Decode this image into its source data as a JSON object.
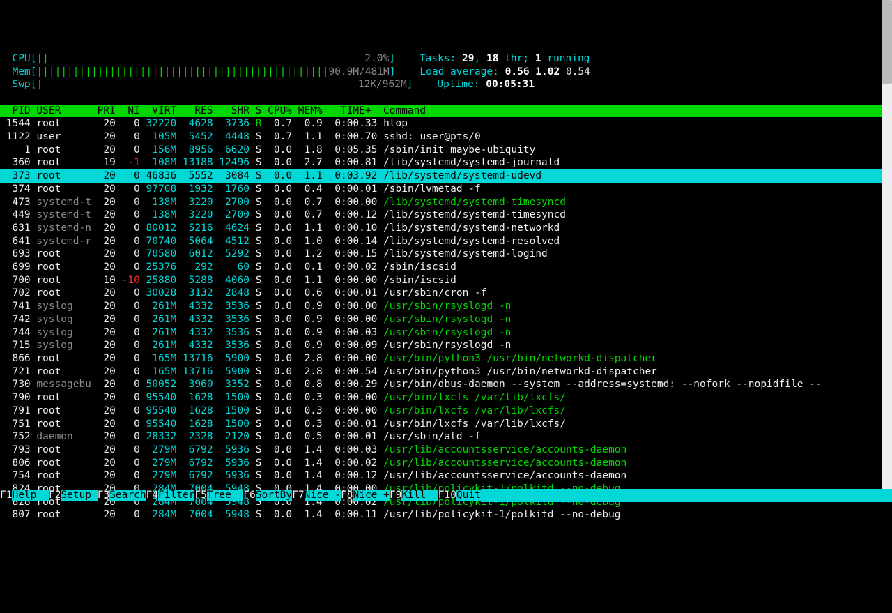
{
  "meters": {
    "cpu": {
      "label": "CPU",
      "bar": "||",
      "pct": "2.0%"
    },
    "mem": {
      "label": "Mem",
      "bar": "||||||||||||||||||||||||||||||||||||||||||||||||",
      "val": "90.9M/481M"
    },
    "swp": {
      "label": "Swp",
      "bar": "|",
      "val": "12K/962M"
    }
  },
  "stats": {
    "tasks_label": "Tasks: ",
    "tasks_total": "29",
    "tasks_thr": "18",
    "tasks_thr_label": " thr; ",
    "tasks_running": "1",
    "tasks_running_label": " running",
    "load_label": "Load average: ",
    "load1": "0.56",
    "load2": "1.02",
    "load3": "0.54",
    "uptime_label": "Uptime: ",
    "uptime": "00:05:31"
  },
  "columns": "  PID USER      PRI  NI  VIRT   RES   SHR S CPU% MEM%   TIME+  Command",
  "selected_pid": "373",
  "processes": [
    {
      "pid": "1544",
      "user": "root",
      "pri": "20",
      "ni": "0",
      "virt": "32220",
      "res": "4628",
      "shr": "3736",
      "s": "R",
      "cpu": "0.7",
      "mem": "0.9",
      "time": "0:00.33",
      "cmd": "htop",
      "hl": false,
      "scol": "green"
    },
    {
      "pid": "1122",
      "user": "user",
      "pri": "20",
      "ni": "0",
      "virt": "105M",
      "res": "5452",
      "shr": "4448",
      "s": "S",
      "cpu": "0.7",
      "mem": "1.1",
      "time": "0:00.70",
      "cmd": "sshd: user@pts/0",
      "hl": false,
      "scol": ""
    },
    {
      "pid": "1",
      "user": "root",
      "pri": "20",
      "ni": "0",
      "virt": "156M",
      "res": "8956",
      "shr": "6620",
      "s": "S",
      "cpu": "0.0",
      "mem": "1.8",
      "time": "0:05.35",
      "cmd": "/sbin/init maybe-ubiquity",
      "hl": false,
      "scol": ""
    },
    {
      "pid": "360",
      "user": "root",
      "pri": "19",
      "ni": "-1",
      "virt": "108M",
      "res": "13188",
      "shr": "12496",
      "s": "S",
      "cpu": "0.0",
      "mem": "2.7",
      "time": "0:00.81",
      "cmd": "/lib/systemd/systemd-journald",
      "hl": false,
      "scol": "",
      "nred": true
    },
    {
      "pid": "373",
      "user": "root",
      "pri": "20",
      "ni": "0",
      "virt": "46836",
      "res": "5552",
      "shr": "3084",
      "s": "S",
      "cpu": "0.0",
      "mem": "1.1",
      "time": "0:03.92",
      "cmd": "/lib/systemd/systemd-udevd",
      "hl": false,
      "scol": ""
    },
    {
      "pid": "374",
      "user": "root",
      "pri": "20",
      "ni": "0",
      "virt": "97708",
      "res": "1932",
      "shr": "1760",
      "s": "S",
      "cpu": "0.0",
      "mem": "0.4",
      "time": "0:00.01",
      "cmd": "/sbin/lvmetad -f",
      "hl": false,
      "scol": ""
    },
    {
      "pid": "473",
      "user": "systemd-t",
      "pri": "20",
      "ni": "0",
      "virt": "138M",
      "res": "3220",
      "shr": "2700",
      "s": "S",
      "cpu": "0.0",
      "mem": "0.7",
      "time": "0:00.00",
      "cmd": "/lib/systemd/systemd-timesyncd",
      "hl": true,
      "scol": ""
    },
    {
      "pid": "449",
      "user": "systemd-t",
      "pri": "20",
      "ni": "0",
      "virt": "138M",
      "res": "3220",
      "shr": "2700",
      "s": "S",
      "cpu": "0.0",
      "mem": "0.7",
      "time": "0:00.12",
      "cmd": "/lib/systemd/systemd-timesyncd",
      "hl": false,
      "scol": ""
    },
    {
      "pid": "631",
      "user": "systemd-n",
      "pri": "20",
      "ni": "0",
      "virt": "80012",
      "res": "5216",
      "shr": "4624",
      "s": "S",
      "cpu": "0.0",
      "mem": "1.1",
      "time": "0:00.10",
      "cmd": "/lib/systemd/systemd-networkd",
      "hl": false,
      "scol": ""
    },
    {
      "pid": "641",
      "user": "systemd-r",
      "pri": "20",
      "ni": "0",
      "virt": "70740",
      "res": "5064",
      "shr": "4512",
      "s": "S",
      "cpu": "0.0",
      "mem": "1.0",
      "time": "0:00.14",
      "cmd": "/lib/systemd/systemd-resolved",
      "hl": false,
      "scol": ""
    },
    {
      "pid": "693",
      "user": "root",
      "pri": "20",
      "ni": "0",
      "virt": "70580",
      "res": "6012",
      "shr": "5292",
      "s": "S",
      "cpu": "0.0",
      "mem": "1.2",
      "time": "0:00.15",
      "cmd": "/lib/systemd/systemd-logind",
      "hl": false,
      "scol": ""
    },
    {
      "pid": "699",
      "user": "root",
      "pri": "20",
      "ni": "0",
      "virt": "25376",
      "res": "292",
      "shr": "60",
      "s": "S",
      "cpu": "0.0",
      "mem": "0.1",
      "time": "0:00.02",
      "cmd": "/sbin/iscsid",
      "hl": false,
      "scol": ""
    },
    {
      "pid": "700",
      "user": "root",
      "pri": "10",
      "ni": "-10",
      "virt": "25880",
      "res": "5288",
      "shr": "4060",
      "s": "S",
      "cpu": "0.0",
      "mem": "1.1",
      "time": "0:00.00",
      "cmd": "/sbin/iscsid",
      "hl": false,
      "scol": "",
      "nred": true
    },
    {
      "pid": "702",
      "user": "root",
      "pri": "20",
      "ni": "0",
      "virt": "30028",
      "res": "3132",
      "shr": "2848",
      "s": "S",
      "cpu": "0.0",
      "mem": "0.6",
      "time": "0:00.01",
      "cmd": "/usr/sbin/cron -f",
      "hl": false,
      "scol": ""
    },
    {
      "pid": "741",
      "user": "syslog",
      "pri": "20",
      "ni": "0",
      "virt": "261M",
      "res": "4332",
      "shr": "3536",
      "s": "S",
      "cpu": "0.0",
      "mem": "0.9",
      "time": "0:00.00",
      "cmd": "/usr/sbin/rsyslogd -n",
      "hl": true,
      "scol": ""
    },
    {
      "pid": "742",
      "user": "syslog",
      "pri": "20",
      "ni": "0",
      "virt": "261M",
      "res": "4332",
      "shr": "3536",
      "s": "S",
      "cpu": "0.0",
      "mem": "0.9",
      "time": "0:00.00",
      "cmd": "/usr/sbin/rsyslogd -n",
      "hl": true,
      "scol": ""
    },
    {
      "pid": "744",
      "user": "syslog",
      "pri": "20",
      "ni": "0",
      "virt": "261M",
      "res": "4332",
      "shr": "3536",
      "s": "S",
      "cpu": "0.0",
      "mem": "0.9",
      "time": "0:00.03",
      "cmd": "/usr/sbin/rsyslogd -n",
      "hl": true,
      "scol": ""
    },
    {
      "pid": "715",
      "user": "syslog",
      "pri": "20",
      "ni": "0",
      "virt": "261M",
      "res": "4332",
      "shr": "3536",
      "s": "S",
      "cpu": "0.0",
      "mem": "0.9",
      "time": "0:00.09",
      "cmd": "/usr/sbin/rsyslogd -n",
      "hl": false,
      "scol": ""
    },
    {
      "pid": "866",
      "user": "root",
      "pri": "20",
      "ni": "0",
      "virt": "165M",
      "res": "13716",
      "shr": "5900",
      "s": "S",
      "cpu": "0.0",
      "mem": "2.8",
      "time": "0:00.00",
      "cmd": "/usr/bin/python3 /usr/bin/networkd-dispatcher",
      "hl": true,
      "scol": ""
    },
    {
      "pid": "721",
      "user": "root",
      "pri": "20",
      "ni": "0",
      "virt": "165M",
      "res": "13716",
      "shr": "5900",
      "s": "S",
      "cpu": "0.0",
      "mem": "2.8",
      "time": "0:00.54",
      "cmd": "/usr/bin/python3 /usr/bin/networkd-dispatcher",
      "hl": false,
      "scol": ""
    },
    {
      "pid": "730",
      "user": "messagebu",
      "pri": "20",
      "ni": "0",
      "virt": "50052",
      "res": "3960",
      "shr": "3352",
      "s": "S",
      "cpu": "0.0",
      "mem": "0.8",
      "time": "0:00.29",
      "cmd": "/usr/bin/dbus-daemon --system --address=systemd: --nofork --nopidfile --",
      "hl": false,
      "scol": ""
    },
    {
      "pid": "790",
      "user": "root",
      "pri": "20",
      "ni": "0",
      "virt": "95540",
      "res": "1628",
      "shr": "1500",
      "s": "S",
      "cpu": "0.0",
      "mem": "0.3",
      "time": "0:00.00",
      "cmd": "/usr/bin/lxcfs /var/lib/lxcfs/",
      "hl": true,
      "scol": ""
    },
    {
      "pid": "791",
      "user": "root",
      "pri": "20",
      "ni": "0",
      "virt": "95540",
      "res": "1628",
      "shr": "1500",
      "s": "S",
      "cpu": "0.0",
      "mem": "0.3",
      "time": "0:00.00",
      "cmd": "/usr/bin/lxcfs /var/lib/lxcfs/",
      "hl": true,
      "scol": ""
    },
    {
      "pid": "751",
      "user": "root",
      "pri": "20",
      "ni": "0",
      "virt": "95540",
      "res": "1628",
      "shr": "1500",
      "s": "S",
      "cpu": "0.0",
      "mem": "0.3",
      "time": "0:00.01",
      "cmd": "/usr/bin/lxcfs /var/lib/lxcfs/",
      "hl": false,
      "scol": ""
    },
    {
      "pid": "752",
      "user": "daemon",
      "pri": "20",
      "ni": "0",
      "virt": "28332",
      "res": "2328",
      "shr": "2120",
      "s": "S",
      "cpu": "0.0",
      "mem": "0.5",
      "time": "0:00.01",
      "cmd": "/usr/sbin/atd -f",
      "hl": false,
      "scol": ""
    },
    {
      "pid": "793",
      "user": "root",
      "pri": "20",
      "ni": "0",
      "virt": "279M",
      "res": "6792",
      "shr": "5936",
      "s": "S",
      "cpu": "0.0",
      "mem": "1.4",
      "time": "0:00.03",
      "cmd": "/usr/lib/accountsservice/accounts-daemon",
      "hl": true,
      "scol": ""
    },
    {
      "pid": "806",
      "user": "root",
      "pri": "20",
      "ni": "0",
      "virt": "279M",
      "res": "6792",
      "shr": "5936",
      "s": "S",
      "cpu": "0.0",
      "mem": "1.4",
      "time": "0:00.02",
      "cmd": "/usr/lib/accountsservice/accounts-daemon",
      "hl": true,
      "scol": ""
    },
    {
      "pid": "754",
      "user": "root",
      "pri": "20",
      "ni": "0",
      "virt": "279M",
      "res": "6792",
      "shr": "5936",
      "s": "S",
      "cpu": "0.0",
      "mem": "1.4",
      "time": "0:00.12",
      "cmd": "/usr/lib/accountsservice/accounts-daemon",
      "hl": false,
      "scol": ""
    },
    {
      "pid": "824",
      "user": "root",
      "pri": "20",
      "ni": "0",
      "virt": "284M",
      "res": "7004",
      "shr": "5948",
      "s": "S",
      "cpu": "0.0",
      "mem": "1.4",
      "time": "0:00.00",
      "cmd": "/usr/lib/policykit-1/polkitd --no-debug",
      "hl": true,
      "scol": ""
    },
    {
      "pid": "828",
      "user": "root",
      "pri": "20",
      "ni": "0",
      "virt": "284M",
      "res": "7004",
      "shr": "5948",
      "s": "S",
      "cpu": "0.0",
      "mem": "1.4",
      "time": "0:00.02",
      "cmd": "/usr/lib/policykit-1/polkitd --no-debug",
      "hl": true,
      "scol": ""
    },
    {
      "pid": "807",
      "user": "root",
      "pri": "20",
      "ni": "0",
      "virt": "284M",
      "res": "7004",
      "shr": "5948",
      "s": "S",
      "cpu": "0.0",
      "mem": "1.4",
      "time": "0:00.11",
      "cmd": "/usr/lib/policykit-1/polkitd --no-debug",
      "hl": false,
      "scol": ""
    }
  ],
  "footer": [
    {
      "key": "F1",
      "label": "Help  "
    },
    {
      "key": "F2",
      "label": "Setup "
    },
    {
      "key": "F3",
      "label": "Search"
    },
    {
      "key": "F4",
      "label": "Filter"
    },
    {
      "key": "F5",
      "label": "Tree  "
    },
    {
      "key": "F6",
      "label": "SortBy"
    },
    {
      "key": "F7",
      "label": "Nice -"
    },
    {
      "key": "F8",
      "label": "Nice +"
    },
    {
      "key": "F9",
      "label": "Kill  "
    },
    {
      "key": "F10",
      "label": "Quit"
    }
  ]
}
